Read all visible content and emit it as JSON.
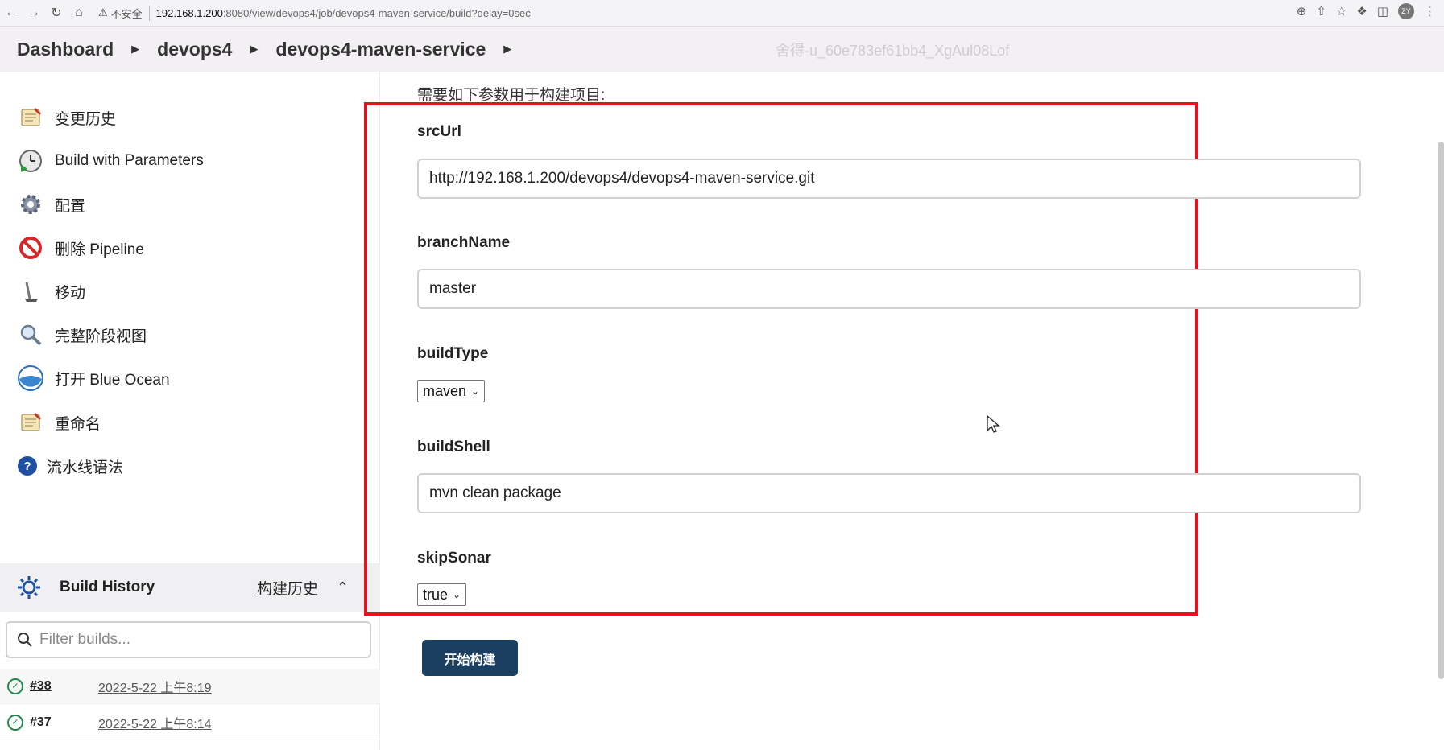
{
  "browser": {
    "insecure_label": "不安全",
    "url_host": "192.168.1.200",
    "url_path": ":8080/view/devops4/job/devops4-maven-service/build?delay=0sec",
    "avatar_text": "ZY"
  },
  "breadcrumb": {
    "items": [
      "Dashboard",
      "devops4",
      "devops4-maven-service"
    ],
    "watermark": "舍得-u_60e783ef61bb4_XgAul08Lof"
  },
  "sidebar": {
    "items": [
      {
        "label": "变更历史",
        "icon": "notepad-icon"
      },
      {
        "label": "Build with Parameters",
        "icon": "clock-play-icon"
      },
      {
        "label": "配置",
        "icon": "gear-icon"
      },
      {
        "label": "删除 Pipeline",
        "icon": "no-entry-icon"
      },
      {
        "label": "移动",
        "icon": "move-icon"
      },
      {
        "label": "完整阶段视图",
        "icon": "magnifier-icon"
      },
      {
        "label": "打开 Blue Ocean",
        "icon": "blue-ocean-icon"
      },
      {
        "label": "重命名",
        "icon": "notepad-icon"
      },
      {
        "label": "流水线语法",
        "icon": "help-icon"
      }
    ],
    "build_history": {
      "title": "Build History",
      "link": "构建历史",
      "filter_placeholder": "Filter builds...",
      "builds": [
        {
          "number": "#38",
          "date": "2022-5-22 上午8:19"
        },
        {
          "number": "#37",
          "date": "2022-5-22 上午8:14"
        }
      ]
    }
  },
  "main": {
    "intro": "需要如下参数用于构建项目:",
    "params": {
      "srcUrl": {
        "label": "srcUrl",
        "value": "http://192.168.1.200/devops4/devops4-maven-service.git"
      },
      "branchName": {
        "label": "branchName",
        "value": "master"
      },
      "buildType": {
        "label": "buildType",
        "value": "maven"
      },
      "buildShell": {
        "label": "buildShell",
        "value": "mvn clean package"
      },
      "skipSonar": {
        "label": "skipSonar",
        "value": "true"
      }
    },
    "submit_label": "开始构建"
  },
  "colors": {
    "highlight_border": "#e8121e",
    "submit_bg": "#1b3f60",
    "success_green": "#1f8a4c"
  }
}
